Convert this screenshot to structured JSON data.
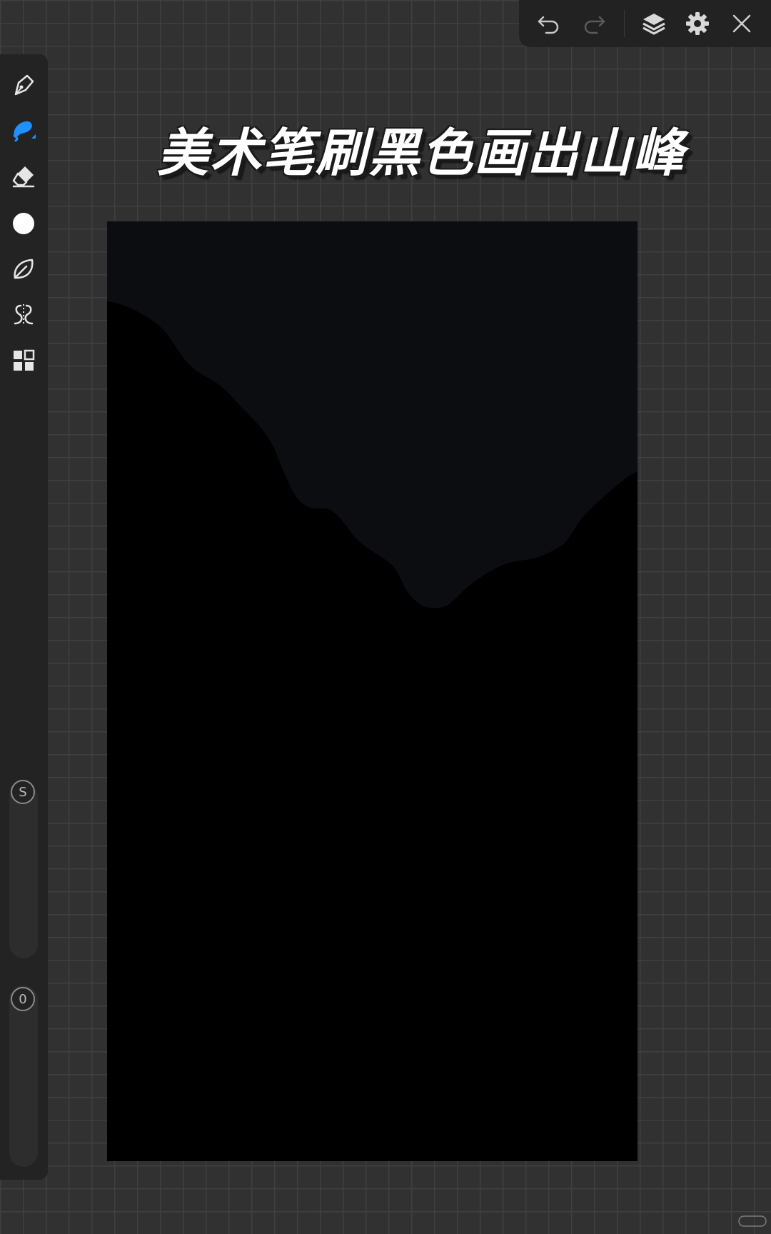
{
  "toolbar": {
    "icons": [
      "undo-icon",
      "redo-icon",
      "layers-icon",
      "settings-gear-icon",
      "close-icon"
    ]
  },
  "sidebar": {
    "tools": [
      "pen-tool-icon",
      "brush-tool-icon",
      "eraser-tool-icon",
      "color-circle-icon",
      "shape-leaf-icon",
      "symmetry-icon",
      "gallery-grid-icon"
    ],
    "active_tool": "brush-tool-icon",
    "accent_color": "#1e90ff",
    "current_color": "#ffffff",
    "size_slider_label": "S",
    "opacity_slider_label": "0"
  },
  "caption": {
    "text": "美术笔刷黑色画出山峰"
  },
  "canvas": {
    "sky_color": "#0b0d10",
    "mountain_color": "#000000"
  }
}
